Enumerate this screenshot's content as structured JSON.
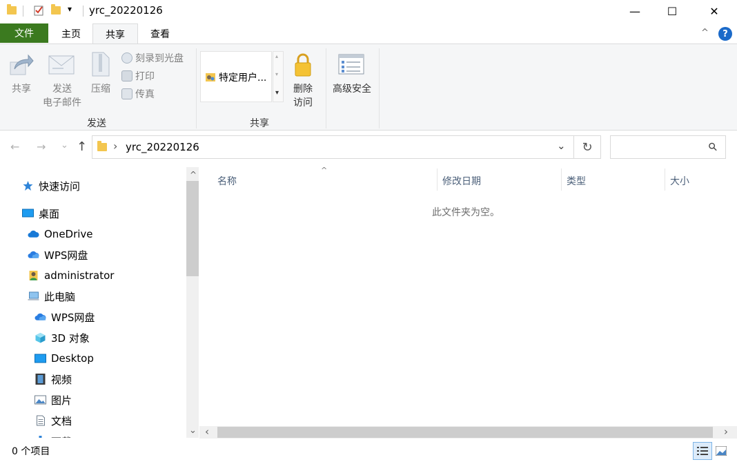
{
  "window": {
    "title": "yrc_20220126",
    "minimize_glyph": "—",
    "maximize_glyph": "☐",
    "close_glyph": "✕"
  },
  "quick_access": {
    "dropdown_glyph": "▾"
  },
  "ribbon_tabs": {
    "file": "文件",
    "home": "主页",
    "share": "共享",
    "view": "查看"
  },
  "ribbon": {
    "collapse_glyph": "^",
    "help_glyph": "?",
    "send_group": {
      "share": "共享",
      "send_email_line1": "发送",
      "send_email_line2": "电子邮件",
      "zip": "压缩",
      "burn": "刻录到光盘",
      "print": "打印",
      "fax": "传真",
      "label": "发送"
    },
    "share_group": {
      "specific_users": "特定用户...",
      "remove_access_line1": "删除",
      "remove_access_line2": "访问",
      "label": "共享"
    },
    "advanced_security": "高级安全"
  },
  "address": {
    "path": "yrc_20220126",
    "back_glyph": "←",
    "forward_glyph": "→",
    "recent_glyph": "⌄",
    "up_glyph": "↑",
    "chevron": "›",
    "dropdown_glyph": "⌄",
    "refresh_glyph": "↻",
    "search_glyph": "⚲"
  },
  "nav_pane": {
    "scroll_up_glyph": "^",
    "scroll_down_glyph": "⌄",
    "items": [
      {
        "label": "快速访问"
      },
      {
        "label": "桌面"
      },
      {
        "label": "OneDrive"
      },
      {
        "label": "WPS网盘"
      },
      {
        "label": "administrator"
      },
      {
        "label": "此电脑"
      },
      {
        "label": "WPS网盘"
      },
      {
        "label": "3D 对象"
      },
      {
        "label": "Desktop"
      },
      {
        "label": "视频"
      },
      {
        "label": "图片"
      },
      {
        "label": "文档"
      },
      {
        "label": "下载"
      }
    ]
  },
  "file_list": {
    "sort_glyph": "^",
    "columns": [
      "名称",
      "修改日期",
      "类型",
      "大小"
    ],
    "empty_message": "此文件夹为空。",
    "scroll_left_glyph": "‹",
    "scroll_right_glyph": "›"
  },
  "status_bar": {
    "item_count": "0 个项目"
  },
  "colors": {
    "file_tab": "#3b7a1f",
    "help": "#1b6ac9",
    "folder": "#f3c64f",
    "accent_blue": "#1e78d2"
  }
}
